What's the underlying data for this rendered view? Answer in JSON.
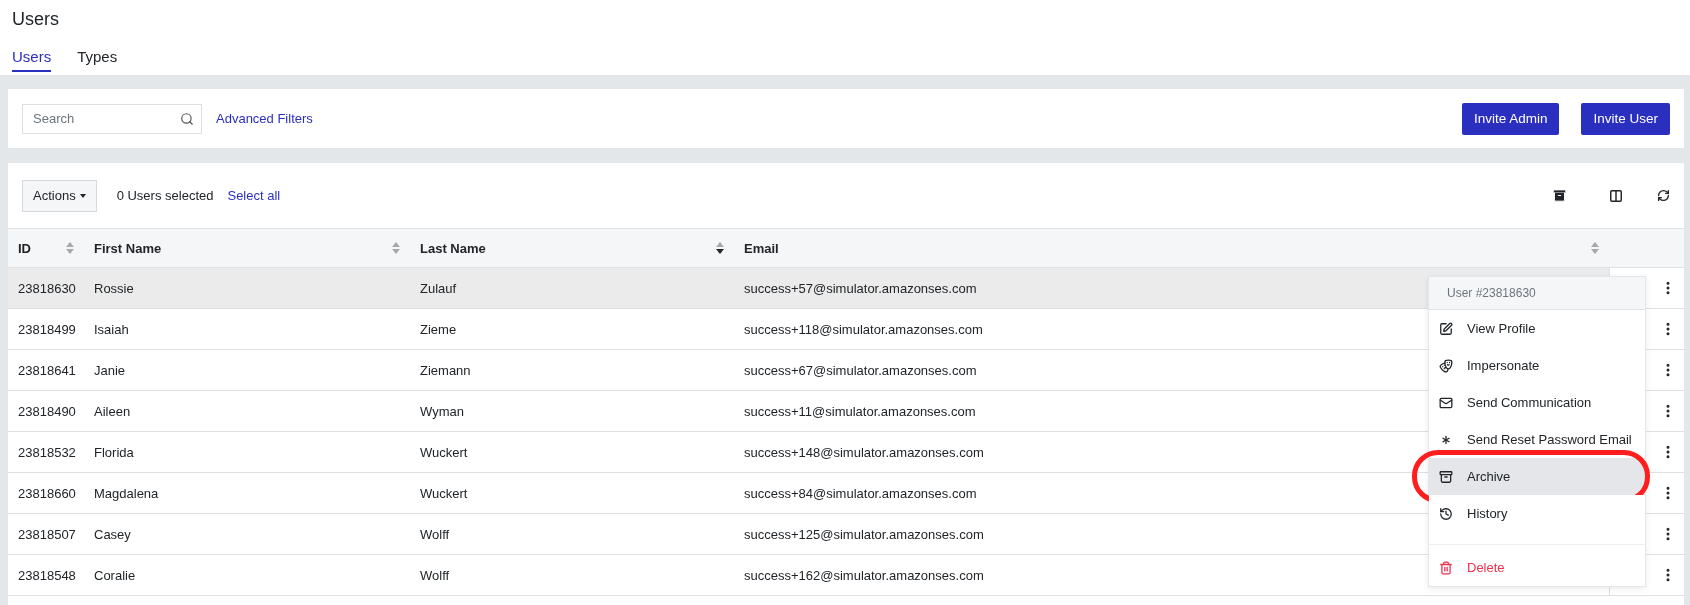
{
  "page_title": "Users",
  "tabs": [
    {
      "label": "Users",
      "selected": true
    },
    {
      "label": "Types",
      "selected": false
    }
  ],
  "filters": {
    "search": {
      "placeholder": "Search"
    },
    "advanced_link": "Advanced Filters",
    "buttons": [
      "Invite Admin",
      "Invite User"
    ]
  },
  "toolbar": {
    "actions_button": "Actions",
    "selection_count": "0 Users selected",
    "select_all": "Select all"
  },
  "table": {
    "columns": [
      {
        "label": "ID",
        "sorted_descending": false
      },
      {
        "label": "First Name",
        "sorted_descending": false
      },
      {
        "label": "Last Name",
        "sorted_descending": true
      },
      {
        "label": "Email",
        "sorted_descending": false
      }
    ],
    "rows": [
      {
        "cells": [
          "23818630",
          "Rossie",
          "Zulauf",
          "success+57@simulator.amazonses.com"
        ],
        "highlighted": true
      },
      {
        "cells": [
          "23818499",
          "Isaiah",
          "Zieme",
          "success+118@simulator.amazonses.com"
        ],
        "highlighted": false
      },
      {
        "cells": [
          "23818641",
          "Janie",
          "Ziemann",
          "success+67@simulator.amazonses.com"
        ],
        "highlighted": false
      },
      {
        "cells": [
          "23818490",
          "Aileen",
          "Wyman",
          "success+11@simulator.amazonses.com"
        ],
        "highlighted": false
      },
      {
        "cells": [
          "23818532",
          "Florida",
          "Wuckert",
          "success+148@simulator.amazonses.com"
        ],
        "highlighted": false
      },
      {
        "cells": [
          "23818660",
          "Magdalena",
          "Wuckert",
          "success+84@simulator.amazonses.com"
        ],
        "highlighted": false
      },
      {
        "cells": [
          "23818507",
          "Casey",
          "Wolff",
          "success+125@simulator.amazonses.com"
        ],
        "highlighted": false
      },
      {
        "cells": [
          "23818548",
          "Coralie",
          "Wolff",
          "success+162@simulator.amazonses.com"
        ],
        "highlighted": false
      }
    ]
  },
  "row_menu": {
    "header": "User #23818630",
    "items": [
      {
        "kind": "edit",
        "label": "View Profile",
        "highlighted": false,
        "circled": false
      },
      {
        "kind": "mask",
        "label": "Impersonate",
        "highlighted": false,
        "circled": false
      },
      {
        "kind": "mail",
        "label": "Send Communication",
        "highlighted": false,
        "circled": false
      },
      {
        "kind": "asterisk",
        "label": "Send Reset Password Email",
        "highlighted": false,
        "circled": false
      },
      {
        "kind": "archive",
        "label": "Archive",
        "highlighted": true,
        "circled": true
      },
      {
        "kind": "history",
        "label": "History",
        "highlighted": false,
        "circled": false
      },
      {
        "kind": "delete",
        "label": "Delete",
        "highlighted": false,
        "circled": false
      }
    ]
  }
}
